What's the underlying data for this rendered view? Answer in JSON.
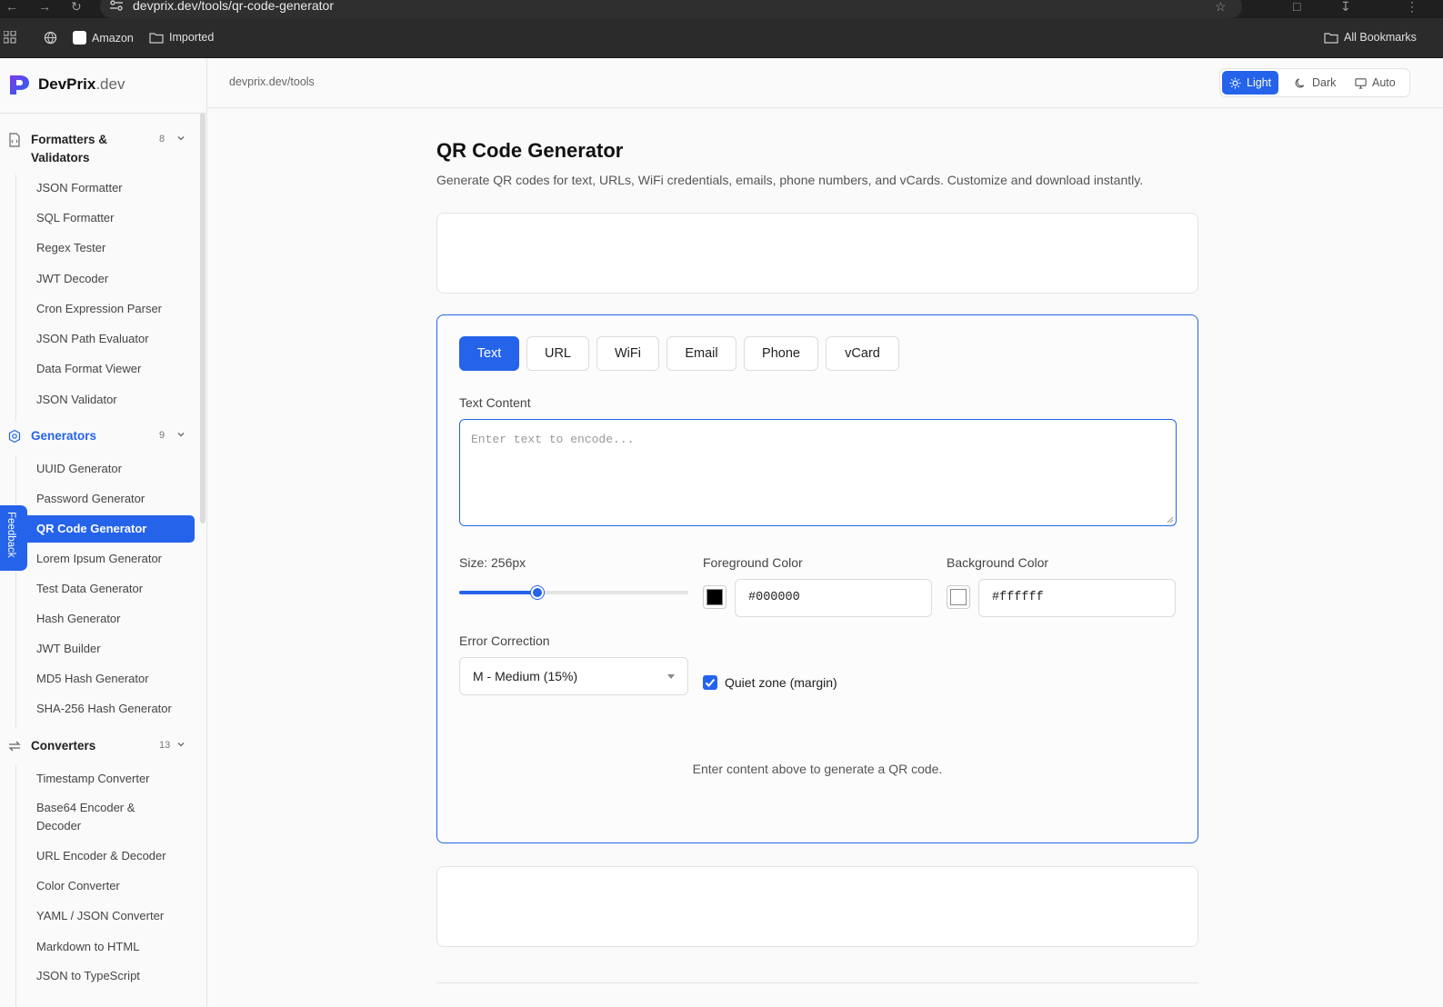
{
  "browser": {
    "url": "devprix.dev/tools/qr-code-generator",
    "bookmarks": [
      {
        "label": "Amazon",
        "icon": "amazon-icon"
      },
      {
        "label": "Imported",
        "icon": "folder-icon"
      }
    ],
    "all_bookmarks": "All Bookmarks"
  },
  "brand": {
    "name": "DevPrix",
    "tld": ".dev",
    "icon": "devprix-logo-icon",
    "accent": "#2563eb"
  },
  "sidebar": {
    "categories": [
      {
        "label": "Formatters & Validators",
        "count": "8",
        "icon": "code-file-icon",
        "items": [
          "JSON Formatter",
          "SQL Formatter",
          "Regex Tester",
          "JWT Decoder",
          "Cron Expression Parser",
          "JSON Path Evaluator",
          "Data Format Viewer",
          "JSON Validator"
        ]
      },
      {
        "label": "Generators",
        "count": "9",
        "icon": "generator-gear-icon",
        "items": [
          "UUID Generator",
          "Password Generator",
          "QR Code Generator",
          "Lorem Ipsum Generator",
          "Test Data Generator",
          "Hash Generator",
          "JWT Builder",
          "MD5 Hash Generator",
          "SHA-256 Hash Generator"
        ]
      },
      {
        "label": "Converters",
        "count": "13",
        "icon": "swap-arrows-icon",
        "items": [
          "Timestamp Converter",
          "Base64 Encoder & Decoder",
          "URL Encoder & Decoder",
          "Color Converter",
          "YAML / JSON Converter",
          "Markdown to HTML",
          "JSON to TypeScript"
        ]
      }
    ],
    "selected_item": "QR Code Generator",
    "feedback_label": "Feedback"
  },
  "header": {
    "breadcrumb": "devprix.dev/tools",
    "theme": {
      "light": "Light",
      "dark": "Dark",
      "auto": "Auto",
      "selected": "Light"
    }
  },
  "main": {
    "title": "QR Code Generator",
    "subtitle": "Generate QR codes for text, URLs, WiFi credentials, emails, phone numbers, and vCards. Customize and download instantly.",
    "tabs": [
      "Text",
      "URL",
      "WiFi",
      "Email",
      "Phone",
      "vCard"
    ],
    "active_tab": "Text",
    "text_content_label": "Text Content",
    "text_placeholder": "Enter text to encode...",
    "size_label": "Size: 256px",
    "size_fraction": 0.34,
    "foreground_label": "Foreground Color",
    "foreground_value": "#000000",
    "background_label": "Background Color",
    "background_value": "#ffffff",
    "error_label": "Error Correction",
    "error_value": "M - Medium (15%)",
    "quiet_zone_label": "Quiet zone (margin)",
    "quiet_zone_checked": true,
    "empty_message": "Enter content above to generate a QR code."
  }
}
